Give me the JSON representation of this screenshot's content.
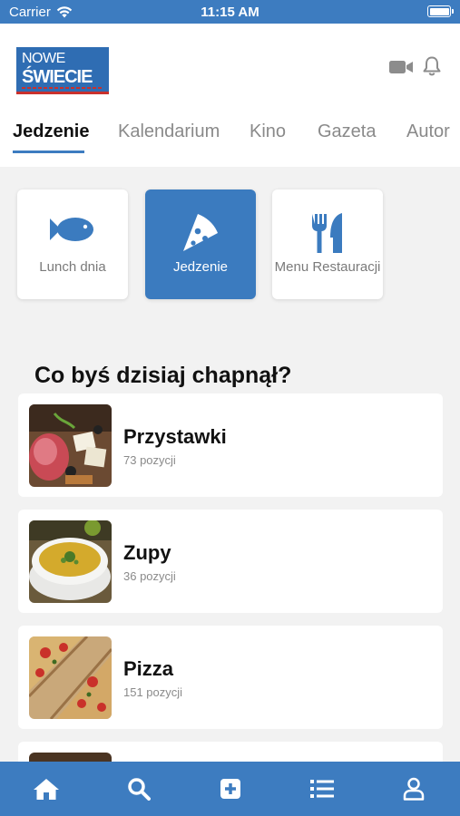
{
  "status": {
    "carrier": "Carrier",
    "time": "11:15 AM"
  },
  "logo": {
    "line1": "NOWE",
    "line2": "ŚWIECIE"
  },
  "tabs": [
    "Jedzenie",
    "Kalendarium",
    "Kino",
    "Gazeta",
    "Autor"
  ],
  "categories": [
    {
      "label": "Lunch dnia",
      "icon": "fish-icon"
    },
    {
      "label": "Jedzenie",
      "icon": "pizza-slice-icon"
    },
    {
      "label": "Menu Restauracji",
      "icon": "utensils-icon"
    }
  ],
  "section_title": "Co byś dzisiaj chapnął?",
  "items": [
    {
      "title": "Przystawki",
      "count": "73 pozycji"
    },
    {
      "title": "Zupy",
      "count": "36 pozycji"
    },
    {
      "title": "Pizza",
      "count": "151 pozycji"
    },
    {
      "title": "",
      "count": ""
    }
  ],
  "colors": {
    "primary": "#3d7cc0",
    "accent": "#c9302c",
    "background": "#f2f2f2"
  },
  "bottom_nav": [
    "home-icon",
    "search-icon",
    "add-icon",
    "list-icon",
    "profile-icon"
  ]
}
